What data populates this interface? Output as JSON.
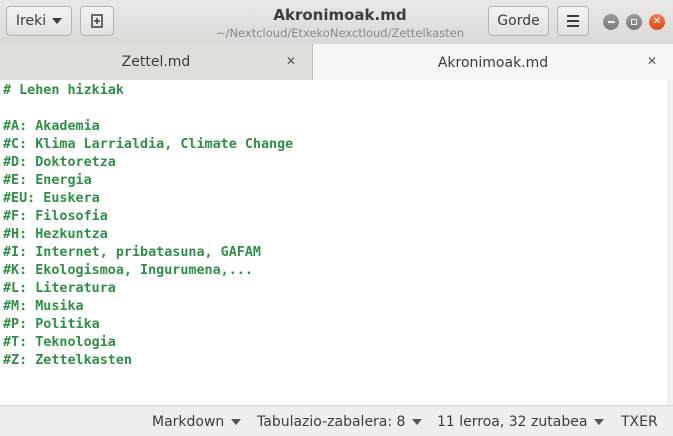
{
  "header": {
    "open_label": "Ireki",
    "save_label": "Gorde",
    "title": "Akronimoak.md",
    "subtitle": "~/Nextcloud/EtxekoNexctloud/Zettelkasten"
  },
  "tabs": [
    {
      "label": "Zettel.md",
      "active": false
    },
    {
      "label": "Akronimoak.md",
      "active": true
    }
  ],
  "editor": {
    "lines": [
      "# Lehen hizkiak",
      "",
      "#A: Akademia",
      "#C: Klima Larrialdia, Climate Change",
      "#D: Doktoretza",
      "#E: Energia",
      "#EU: Euskera",
      "#F: Filosofia",
      "#H: Hezkuntza",
      "#I: Internet, pribatasuna, GAFAM",
      "#K: Ekologismoa, Ingurumena,...",
      "#L: Literatura",
      "#M: Musika",
      "#P: Politika",
      "#T: Teknologia",
      "#Z: Zettelkasten"
    ],
    "text_color": "#2f8f46"
  },
  "statusbar": {
    "language": "Markdown",
    "tab_width": "Tabulazio-zabalera: 8",
    "position": "11 lerroa, 32 zutabea",
    "mode": "TXER"
  },
  "colors": {
    "close_button": "#dd4814"
  }
}
